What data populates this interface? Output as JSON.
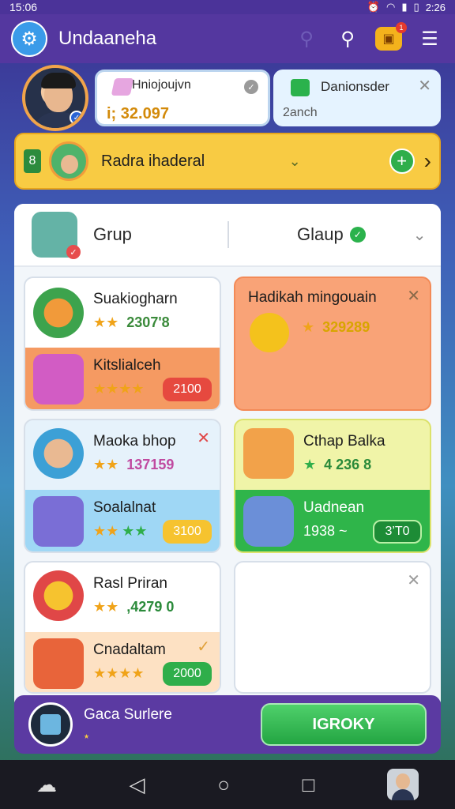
{
  "status": {
    "time": "15:06",
    "right_time": "2:26",
    "icons": [
      "alarm-icon",
      "wifi-icon",
      "signal-icon",
      "battery-icon"
    ]
  },
  "topbar": {
    "title": "Undaaneha",
    "icons": [
      "app-logo-icon",
      "search-faded-icon",
      "search-icon",
      "shop-icon",
      "menu-icon"
    ],
    "shop_badge": "1"
  },
  "currency": {
    "title": "Hniojoujvn",
    "amount": "i; 32.097"
  },
  "notify": {
    "title": "Danionsder",
    "sub": "2anch"
  },
  "quest": {
    "tag": "8",
    "title": "Radra ihaderal"
  },
  "panel": {
    "tab1": "Grup",
    "tab2": "Glaup"
  },
  "tiles": [
    {
      "title": "Suakiogharn",
      "stars": "2307'8",
      "bottom_title": "Kitslialceh",
      "bottom_value": "2100"
    },
    {
      "title": "Hadikah mingouain",
      "stars": "329289"
    },
    {
      "title": "Maoka bhop",
      "stars": "137159",
      "bottom_title": "Soalalnat",
      "bottom_value": "3100"
    },
    {
      "title": "Cthap Balka",
      "stars": "4  236 8",
      "bottom_title": "Uadnean",
      "bottom_sub": "1938 ~",
      "bottom_value": "3’T0"
    },
    {
      "title": "Rasl Priran",
      "stars": ",4279 0",
      "bottom_title": "Cnadaltam",
      "bottom_value": "2000"
    }
  ],
  "bottom": {
    "title": "Gaca Surlere",
    "sub": "⭑",
    "button": "IGROKY"
  },
  "colors": {
    "accent": "#54379f",
    "quest": "#f8cb43",
    "green": "#2bb24c",
    "orange": "#f59a62",
    "red_btn": "#e6493f"
  }
}
